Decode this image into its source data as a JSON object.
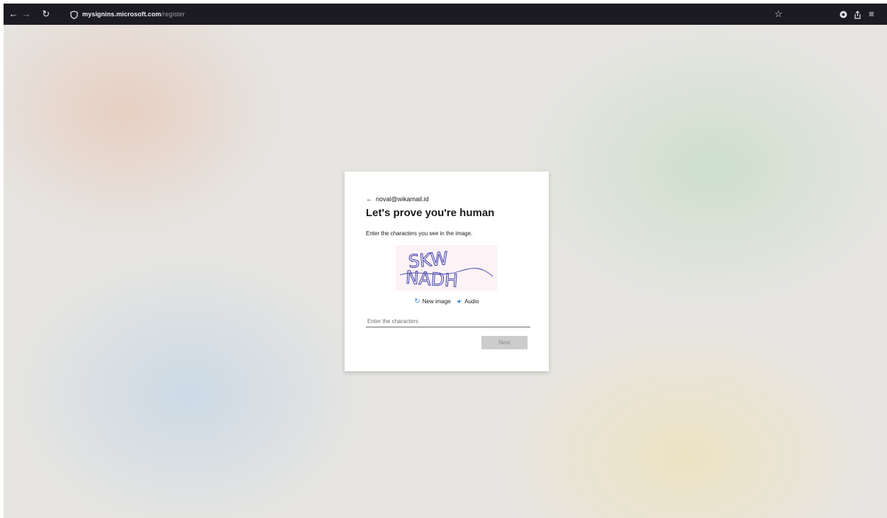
{
  "browser": {
    "url_host": "mysignins.microsoft.com",
    "url_path": "/register",
    "icons": [
      "back-arrow-icon",
      "forward-arrow-icon",
      "reload-icon",
      "shield-icon",
      "bookmark-star-icon",
      "extension-icon",
      "share-icon",
      "menu-icon"
    ]
  },
  "card": {
    "email": "noval@wikamail.id",
    "title": "Let's prove you're human",
    "description": "Enter the characters you see in the image.",
    "captcha_text": [
      "SKW",
      "NADH"
    ],
    "new_image_label": "New image",
    "audio_label": "Audio",
    "input_placeholder": "Enter the characters",
    "next_label": "Next"
  },
  "colors": {
    "toolbar_bg": "#1c1b22",
    "accent_icon": "#3b8ad9",
    "captcha_ink": "#3a3ea8",
    "captcha_bg": "#fdf2f5",
    "button_disabled": "#cccccc"
  }
}
